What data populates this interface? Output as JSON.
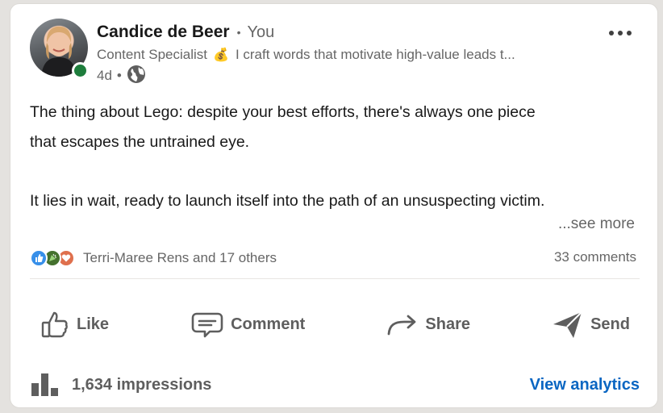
{
  "post": {
    "author_name": "Candice de Beer",
    "separator": "•",
    "degree": "You",
    "headline_prefix": "Content Specialist",
    "headline_emoji": "💰",
    "headline_rest": "I craft words that motivate high-value leads t...",
    "age": "4d",
    "meta_separator": "•",
    "visibility_icon": "globe-icon",
    "body_lines": [
      "The thing about Lego: despite your best efforts, there's always one piece",
      "that escapes the untrained eye.",
      "",
      "It lies in wait, ready to launch itself into the path of an unsuspecting victim."
    ],
    "see_more": "...see more"
  },
  "social": {
    "reaction_icons": [
      "like-reaction-icon",
      "celebrate-reaction-icon",
      "love-reaction-icon"
    ],
    "reactions_text": "Terri-Maree Rens and 17 others",
    "comments_text": "33 comments"
  },
  "actions": {
    "like": "Like",
    "comment": "Comment",
    "share": "Share",
    "send": "Send"
  },
  "footer": {
    "impressions": "1,634 impressions",
    "view_analytics": "View analytics"
  },
  "colors": {
    "brand_blue": "#0a66c2",
    "online_green": "#1e7d3c",
    "muted_text": "#666666"
  }
}
